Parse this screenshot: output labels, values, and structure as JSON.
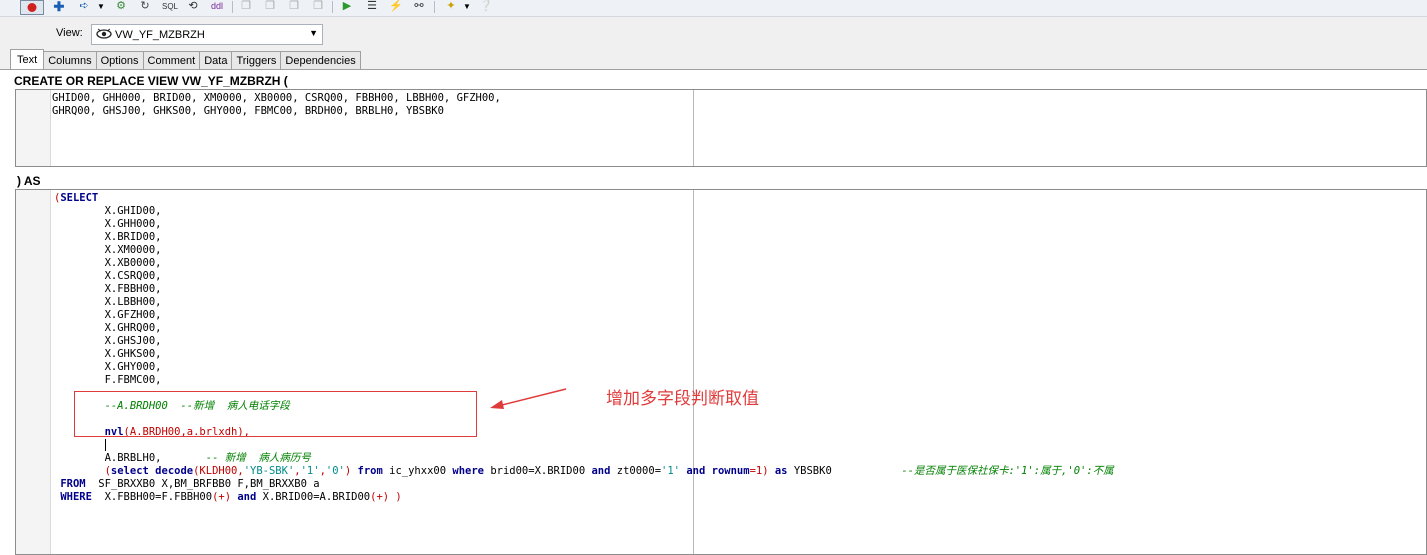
{
  "toolbar": {
    "icons": [
      "record-icon",
      "add-icon",
      "arrow-icon",
      "dropdown-icon",
      "wrench-icon",
      "refresh-icon",
      "sql-icon",
      "compile-icon",
      "ddl-icon",
      "copy-icon",
      "paste-icon",
      "cut-icon",
      "print-icon",
      "run-icon",
      "list-icon",
      "lightning-icon",
      "binoculars-icon",
      "magic-icon",
      "help-icon"
    ],
    "sql_label": "SQL",
    "ddl_label": "ddl"
  },
  "view": {
    "label": "View:",
    "value": "VW_YF_MZBRZH"
  },
  "tabs": [
    "Text",
    "Columns",
    "Options",
    "Comment",
    "Data",
    "Triggers",
    "Dependencies"
  ],
  "active_tab": "Text",
  "header1": "CREATE OR REPLACE VIEW VW_YF_MZBRZH (",
  "columns_lines": [
    "GHID00, GHH000, BRID00, XM0000, XB0000, CSRQ00, FBBH00, LBBH00, GFZH00,",
    "GHRQ00, GHSJ00, GHKS00, GHY000, FBMC00, BRDH00, BRBLH0, YBSBK0"
  ],
  "header2": ") AS",
  "sql": {
    "select_kw": "SELECT",
    "open_paren": "(",
    "fields": [
      "X.GHID00,",
      "X.GHH000,",
      "X.BRID00,",
      "X.XM0000,",
      "X.XB0000,",
      "X.CSRQ00,",
      "X.FBBH00,",
      "X.LBBH00,",
      "X.GFZH00,",
      "X.GHRQ00,",
      "X.GHSJ00,",
      "X.GHKS00,",
      "X.GHY000,",
      "F.FBMC00,"
    ],
    "comment_brdh": "--A.BRDH00  --新增  病人电话字段",
    "nvl_kw": "nvl",
    "nvl_args": "(A.BRDH00,a.brlxdh),",
    "brblh_field": "A.BRBLH0,",
    "brblh_comment": "-- 新增  病人病历号",
    "sub_open": "(",
    "sub_select": "select",
    "sub_decode": "decode",
    "sub_args_1": "(KLDH00,",
    "sub_str_1": "'YB-SBK'",
    "sub_comma_1": ",",
    "sub_str_2": "'1'",
    "sub_comma_2": ",",
    "sub_str_3": "'0'",
    "sub_close_1": ")",
    "sub_from": "from",
    "sub_table": "ic_yhxx00",
    "sub_where": "where",
    "sub_cond_1": "brid00=X.BRID00",
    "sub_and_1": "and",
    "sub_cond_2": "zt0000=",
    "sub_str_4": "'1'",
    "sub_and_2": "and",
    "sub_rownum": "rownum",
    "sub_eq": "=1)",
    "sub_as": "as",
    "sub_alias": "YBSBK0",
    "sub_comment": "--是否属于医保社保卡:'1':属于,'0':不属",
    "from_kw": "FROM",
    "from_tables": "SF_BRXXB0 X,BM_BRFBB0 F,BM_BRXXB0 a",
    "where_kw": "WHERE",
    "where_c1": "X.FBBH00=F.FBBH00",
    "where_p1": "(+)",
    "where_and": "and",
    "where_c2": "X.BRID00=A.BRID00",
    "where_p2": "(+)",
    "where_close": ")"
  },
  "annotation": {
    "text": "增加多字段判断取值",
    "color": "#e03b3b"
  }
}
